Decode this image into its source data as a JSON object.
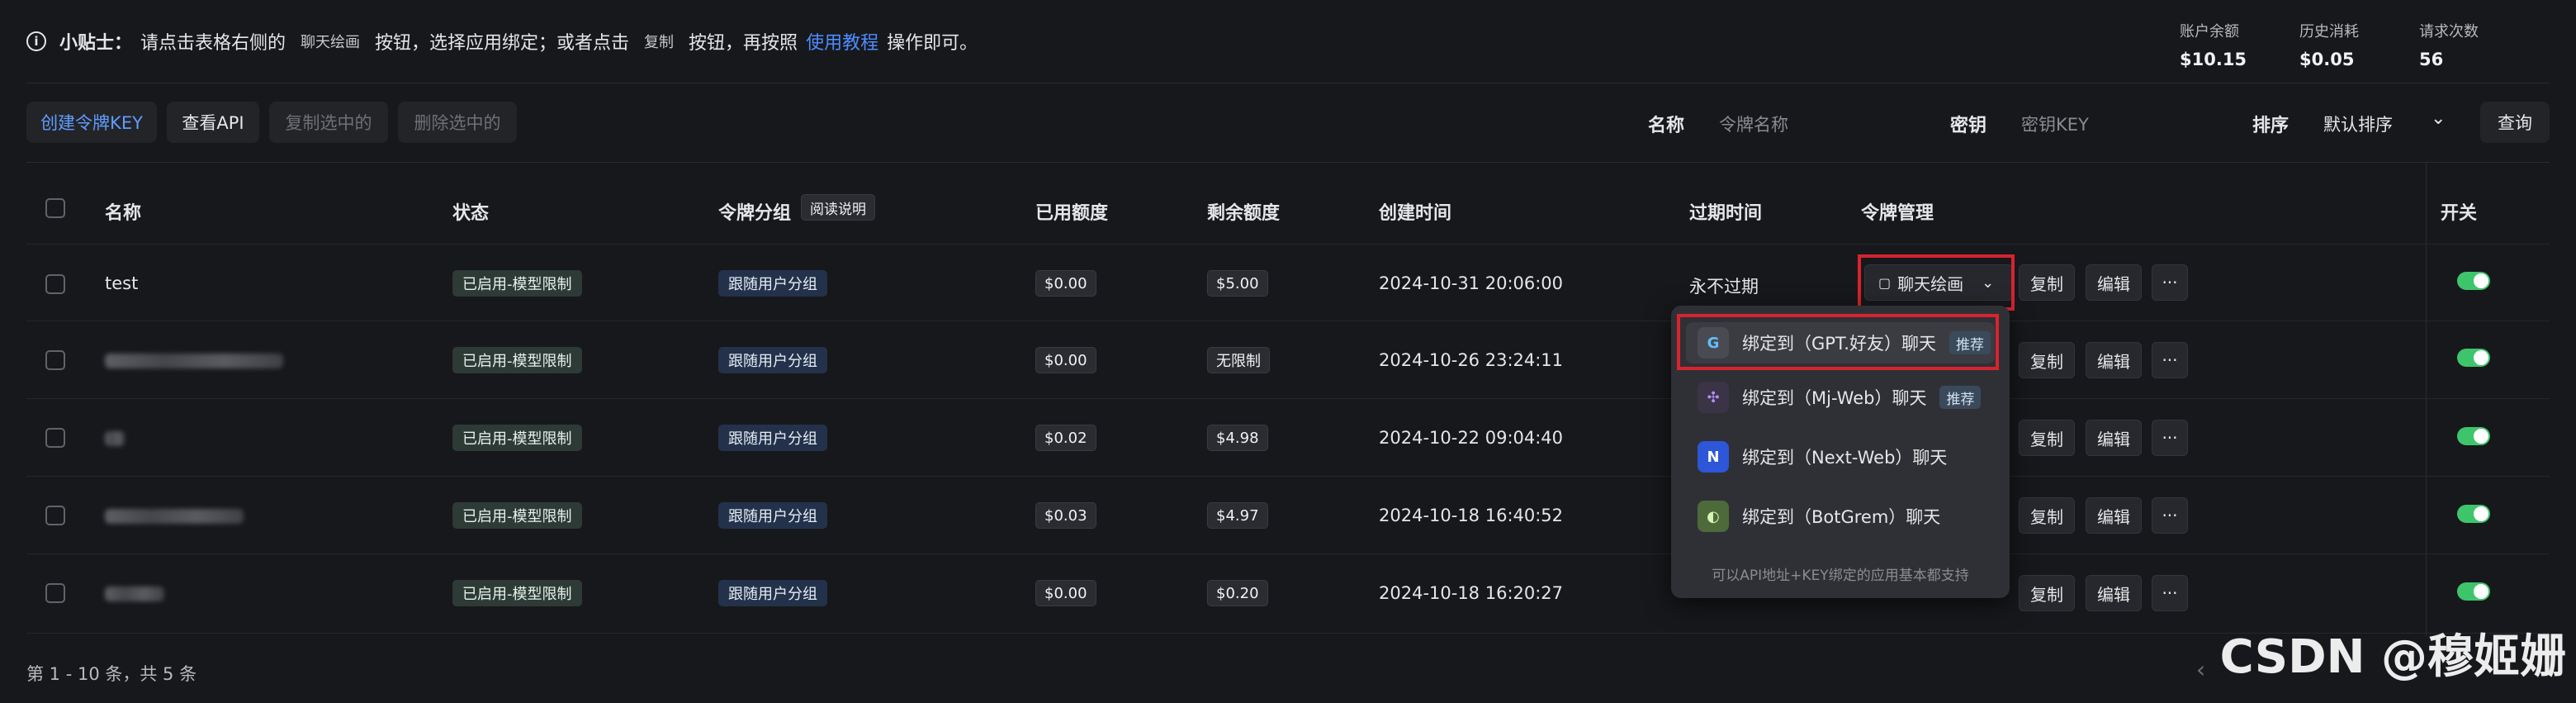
{
  "tip": {
    "prefix": "小贴士：",
    "text1": "请点击表格右侧的",
    "chat_draw": "聊天绘画",
    "text2": "按钮，选择应用绑定；或者点击",
    "copy": "复制",
    "text3": "按钮，再按照",
    "link": "使用教程",
    "text4": "操作即可。"
  },
  "stats": [
    {
      "label": "账户余额",
      "value": "$10.15"
    },
    {
      "label": "历史消耗",
      "value": "$0.05"
    },
    {
      "label": "请求次数",
      "value": "56"
    }
  ],
  "toolbar": {
    "create": "创建令牌KEY",
    "view_api": "查看API",
    "copy_selected": "复制选中的",
    "delete_selected": "删除选中的",
    "name_label": "名称",
    "name_placeholder": "令牌名称",
    "key_label": "密钥",
    "key_placeholder": "密钥KEY",
    "sort_label": "排序",
    "sort_value": "默认排序",
    "query": "查询"
  },
  "table": {
    "headers": {
      "name": "名称",
      "status": "状态",
      "group": "令牌分组",
      "group_help": "阅读说明",
      "used": "已用额度",
      "remain": "剩余额度",
      "created": "创建时间",
      "expire": "过期时间",
      "manage": "令牌管理",
      "switch": "开关"
    },
    "rows": [
      {
        "name": "test",
        "status": "已启用-模型限制",
        "group": "跟随用户分组",
        "used": "$0.00",
        "remain": "$5.00",
        "created": "2024-10-31 20:06:00",
        "expire": "永不过期"
      },
      {
        "name": "",
        "status": "已启用-模型限制",
        "group": "跟随用户分组",
        "used": "$0.00",
        "remain": "无限制",
        "created": "2024-10-26 23:24:11",
        "expire": ""
      },
      {
        "name": "",
        "status": "已启用-模型限制",
        "group": "跟随用户分组",
        "used": "$0.02",
        "remain": "$4.98",
        "created": "2024-10-22 09:04:40",
        "expire": ""
      },
      {
        "name": "",
        "status": "已启用-模型限制",
        "group": "跟随用户分组",
        "used": "$0.03",
        "remain": "$4.97",
        "created": "2024-10-18 16:40:52",
        "expire": ""
      },
      {
        "name": "",
        "status": "已启用-模型限制",
        "group": "跟随用户分组",
        "used": "$0.00",
        "remain": "$0.20",
        "created": "2024-10-18 16:20:27",
        "expire": ""
      }
    ],
    "manage_button": "聊天绘画",
    "copy_button": "复制",
    "edit_button": "编辑",
    "more_button": "···"
  },
  "dropdown": {
    "items": [
      {
        "label": "绑定到（GPT.好友）聊天",
        "badge": "推荐",
        "icon": "G"
      },
      {
        "label": "绑定到（Mj-Web）聊天",
        "badge": "推荐",
        "icon": "✣"
      },
      {
        "label": "绑定到（Next-Web）聊天",
        "badge": "",
        "icon": "N"
      },
      {
        "label": "绑定到（BotGrem）聊天",
        "badge": "",
        "icon": "◐"
      }
    ],
    "footer": "可以API地址+KEY绑定的应用基本都支持"
  },
  "footer": {
    "summary": "第 1 - 10 条，共 5 条"
  },
  "watermark": "CSDN @穆姬姗",
  "colors": {
    "accent": "#4c8dff",
    "highlight": "#d8232f",
    "toggle_on": "#3ec56c"
  }
}
